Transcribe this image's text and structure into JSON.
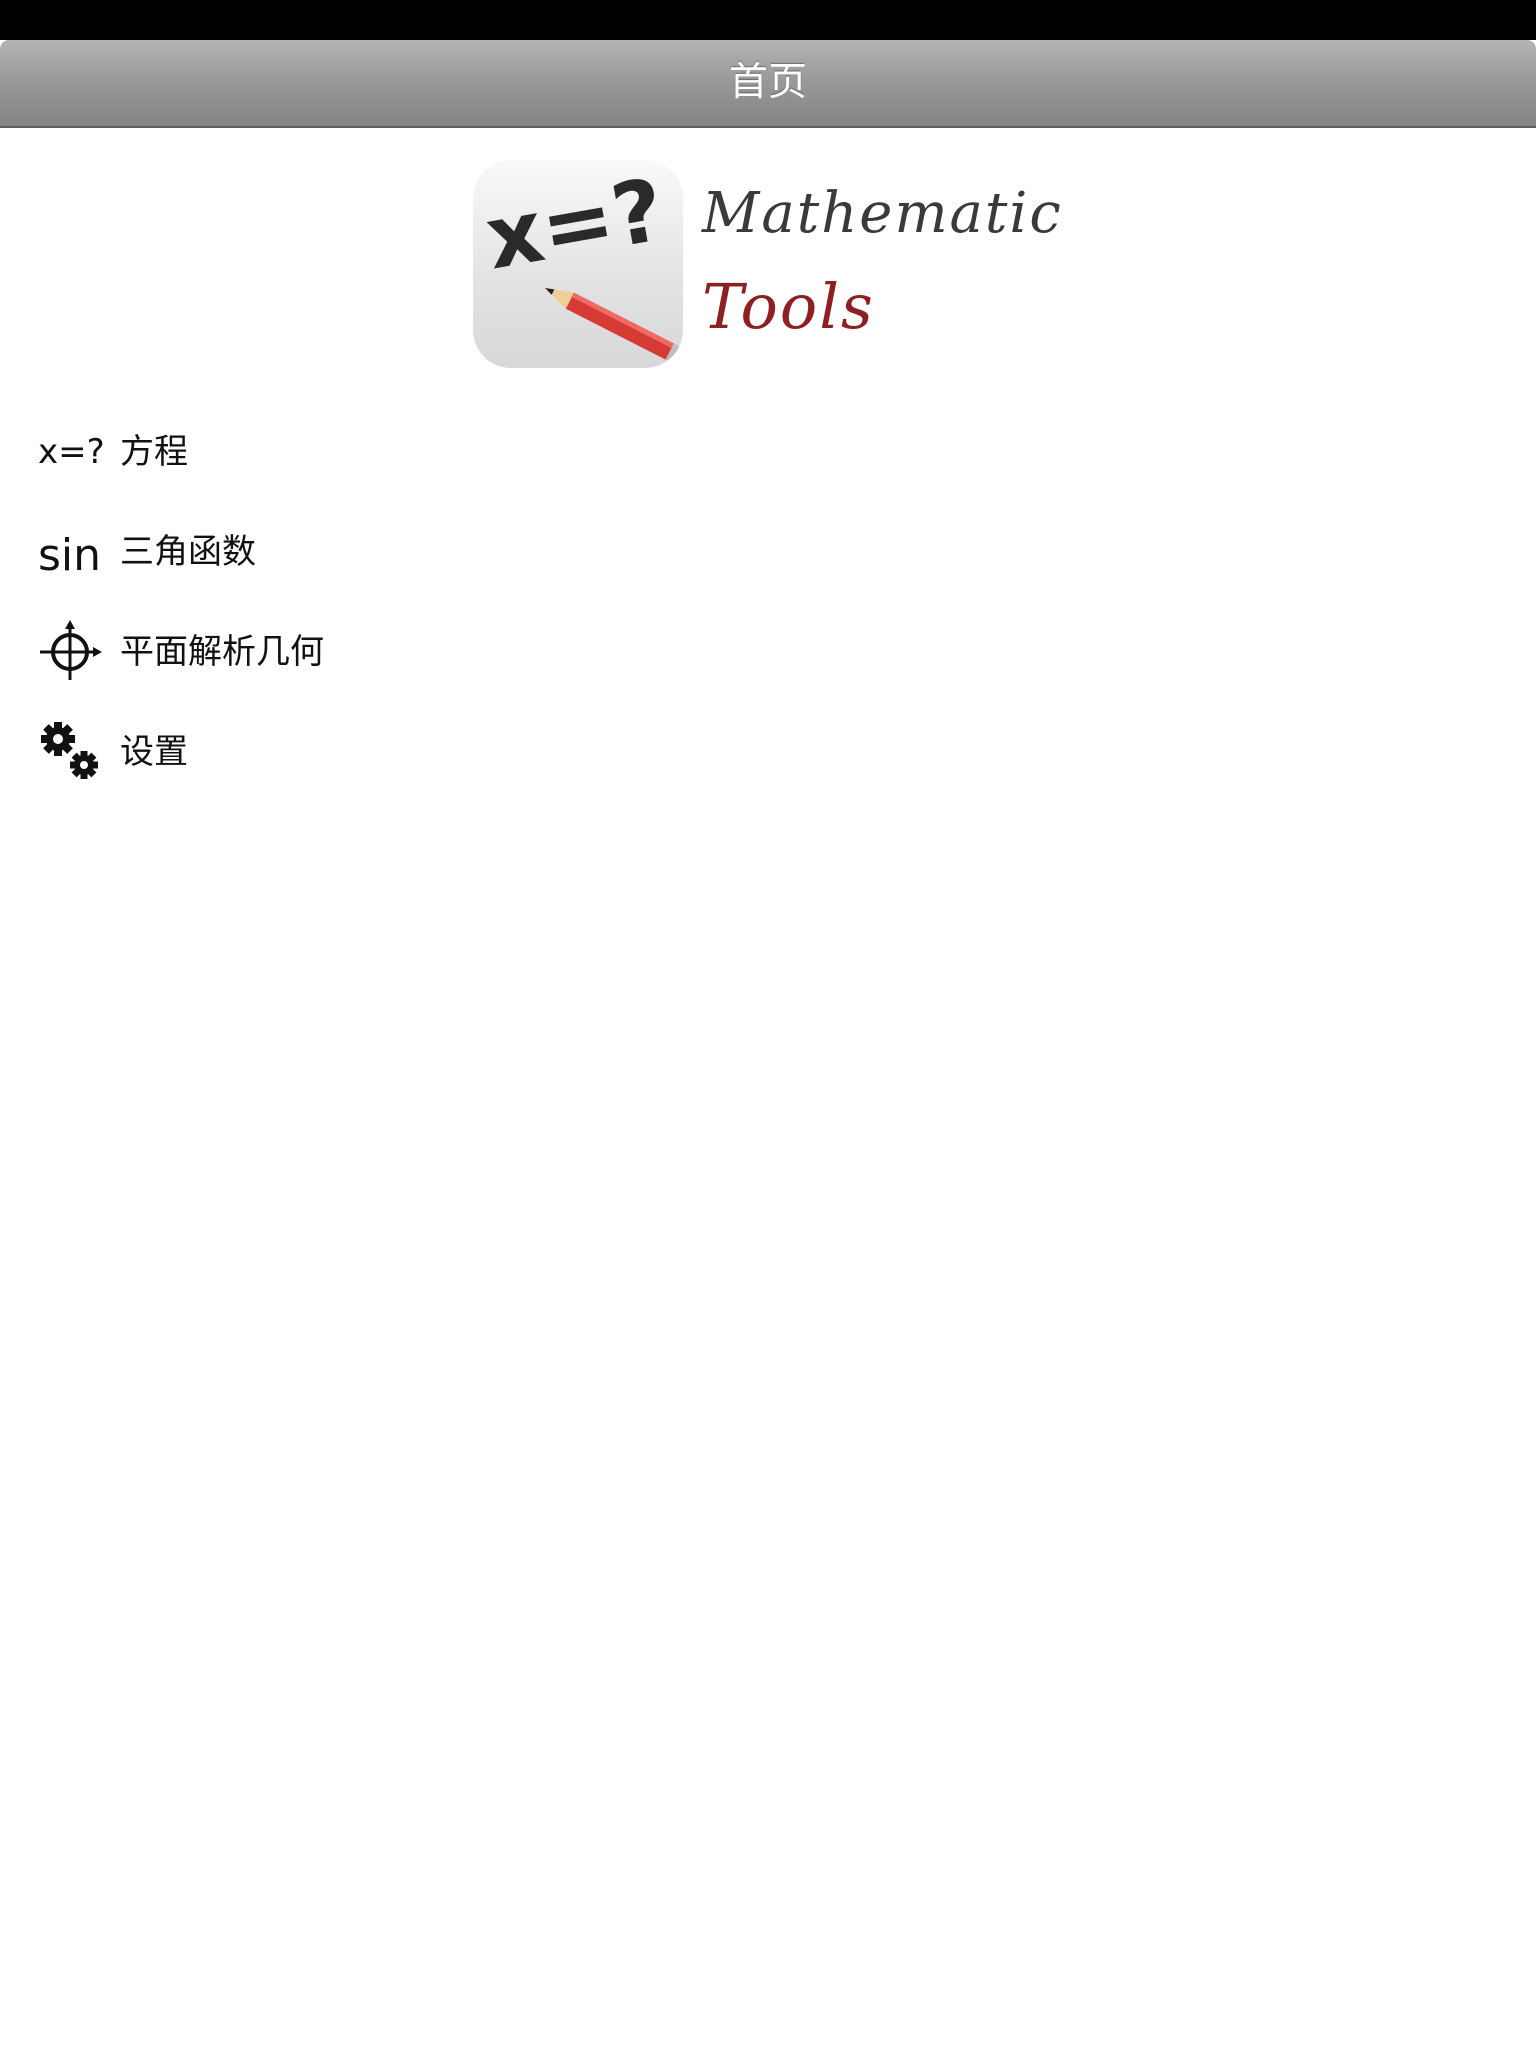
{
  "nav": {
    "title": "首页"
  },
  "logo": {
    "tile_text": "x=?",
    "line1": "Mathematic",
    "line2": "Tools",
    "line2_color": "#8e2023"
  },
  "menu": {
    "items": [
      {
        "icon": "equation-icon",
        "icon_text": "x=?",
        "label": "方程"
      },
      {
        "icon": "sine-icon",
        "icon_text": "sin",
        "label": "三角函数"
      },
      {
        "icon": "crosshair-axes-icon",
        "label": "平面解析几何"
      },
      {
        "icon": "gears-icon",
        "label": "设置"
      }
    ]
  },
  "colors": {
    "status_bar": "#000000",
    "nav_bar": "#9a9a9a",
    "background": "#ffffff",
    "pencil": "#d63a35"
  }
}
